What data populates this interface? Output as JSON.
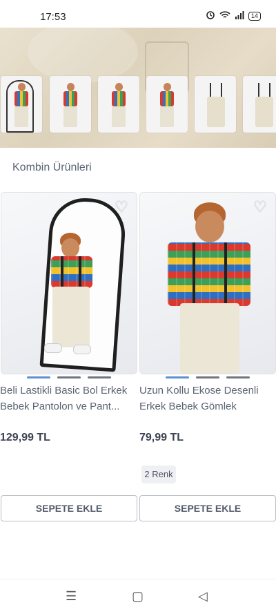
{
  "status_bar": {
    "time": "17:53",
    "battery": "14",
    "icons": [
      "alarm-icon",
      "wifi-icon",
      "signal-icon",
      "battery-icon"
    ]
  },
  "gallery": {
    "thumbnails": [
      "thumb-1",
      "thumb-2",
      "thumb-3",
      "thumb-4",
      "thumb-5",
      "thumb-6"
    ]
  },
  "section": {
    "title": "Kombin Ürünleri"
  },
  "products": [
    {
      "name": "Beli Lastikli Basic Bol Erkek Bebek Pantolon ve Pantolon Askısı",
      "name_display": "Beli Lastikli Basic Bol Erkek Bebek Pantolon ve Pant...",
      "price": "129,99 TL",
      "button": "SEPETE EKLE",
      "image_dots": 3,
      "active_dot": 0
    },
    {
      "name": "Uzun Kollu Ekose Desenli Erkek Bebek Gömlek",
      "price": "79,99 TL",
      "button": "SEPETE EKLE",
      "colors_badge": "2 Renk",
      "image_dots": 3,
      "active_dot": 0
    }
  ],
  "colors": {
    "accent_dot": "#5e8fd0",
    "text": "#5b6473",
    "price": "#3a4150"
  },
  "nav_bar": {
    "menu": "☰",
    "home": "▢",
    "back": "◁"
  }
}
